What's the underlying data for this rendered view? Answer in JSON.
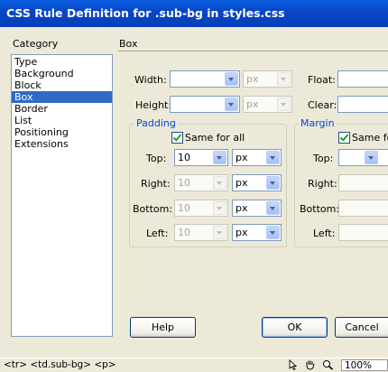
{
  "window": {
    "title": "CSS Rule Definition for .sub-bg in styles.css"
  },
  "category": {
    "label": "Category",
    "items": [
      {
        "label": "Type",
        "selected": false
      },
      {
        "label": "Background",
        "selected": false
      },
      {
        "label": "Block",
        "selected": false
      },
      {
        "label": "Box",
        "selected": true
      },
      {
        "label": "Border",
        "selected": false
      },
      {
        "label": "List",
        "selected": false
      },
      {
        "label": "Positioning",
        "selected": false
      },
      {
        "label": "Extensions",
        "selected": false
      }
    ]
  },
  "section": {
    "title": "Box"
  },
  "box": {
    "width_label": "Width:",
    "width_value": "",
    "width_unit": "px",
    "height_label": "Height:",
    "height_value": "",
    "height_unit": "px",
    "float_label": "Float:",
    "clear_label": "Clear:"
  },
  "padding": {
    "legend": "Padding",
    "same_for_all": "Same for all",
    "same_for_all_checked": true,
    "top_label": "Top:",
    "top_value": "10",
    "top_unit": "px",
    "right_label": "Right:",
    "right_value": "10",
    "right_unit": "px",
    "bottom_label": "Bottom:",
    "bottom_value": "10",
    "bottom_unit": "px",
    "left_label": "Left:",
    "left_value": "10",
    "left_unit": "px"
  },
  "margin": {
    "legend": "Margin",
    "same_for_all": "Same fo",
    "same_for_all_checked": true,
    "top_label": "Top:",
    "right_label": "Right:",
    "bottom_label": "Bottom:",
    "left_label": "Left:"
  },
  "buttons": {
    "help": "Help",
    "ok": "OK",
    "cancel": "Cancel"
  },
  "statusbar": {
    "tag_path": "<tr> <td.sub-bg> <p>",
    "zoom": "100%"
  },
  "colors": {
    "title_bar": "#0a5fe0",
    "selection": "#316ac5",
    "group_label": "#0046d5"
  }
}
